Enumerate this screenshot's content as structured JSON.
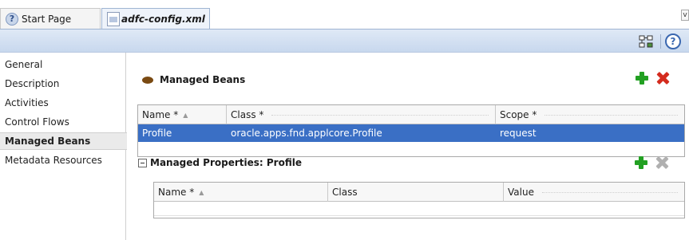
{
  "tabs": [
    {
      "label": "Start Page",
      "icon": "help-circle-icon"
    },
    {
      "label": "adfc-config.xml",
      "icon": "xml-file-icon"
    }
  ],
  "tab_scroll_label": "v",
  "toolbar": {
    "layout_icon": "diagram-layout-icon",
    "help_label": "?"
  },
  "nav": {
    "items": [
      {
        "label": "General"
      },
      {
        "label": "Description"
      },
      {
        "label": "Activities"
      },
      {
        "label": "Control Flows"
      },
      {
        "label": "Managed Beans",
        "selected": true
      },
      {
        "label": "Metadata Resources"
      }
    ]
  },
  "beans": {
    "title": "Managed Beans",
    "columns": [
      "Name *",
      "Class *",
      "Scope *"
    ],
    "rows": [
      {
        "name": "Profile",
        "class": "oracle.apps.fnd.applcore.Profile",
        "scope": "request"
      }
    ]
  },
  "properties": {
    "title": "Managed Properties: Profile",
    "columns": [
      "Name *",
      "Class",
      "Value"
    ],
    "rows": []
  },
  "colors": {
    "selection": "#3a6fc5",
    "add": "#22a022",
    "delete": "#d42b1e",
    "toolbar": "#c8d8ee"
  }
}
